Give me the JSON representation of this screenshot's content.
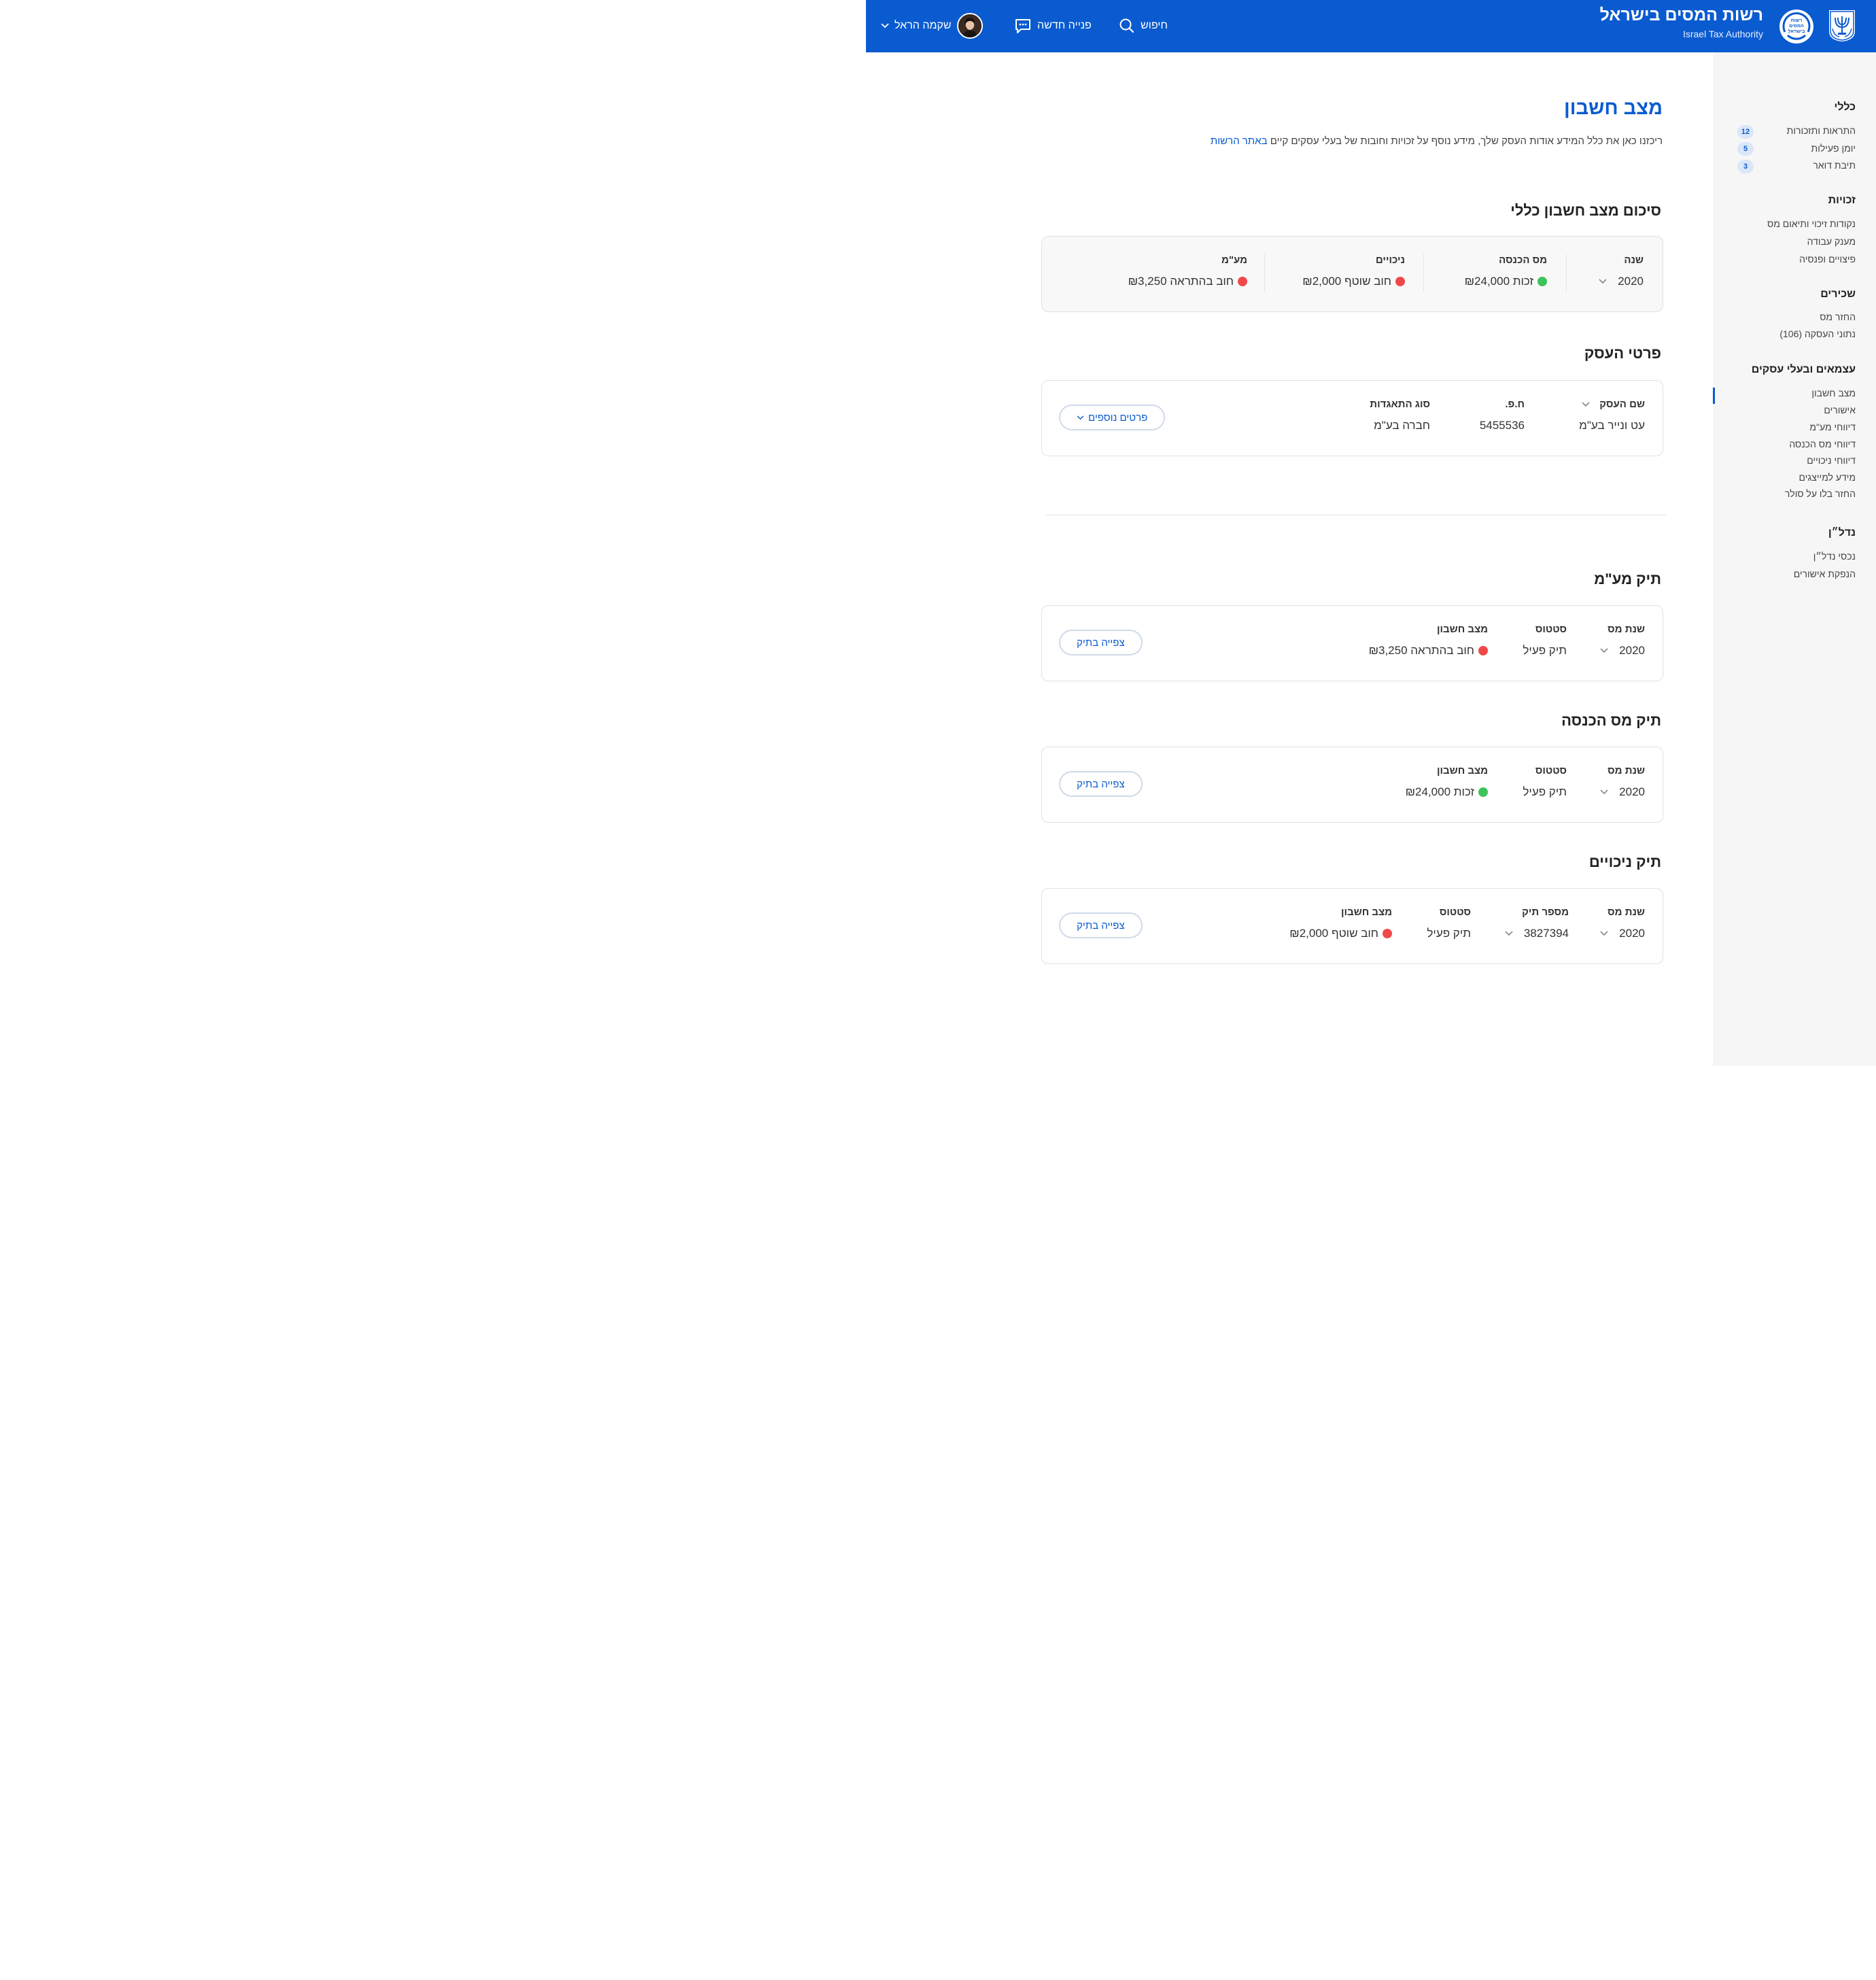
{
  "header": {
    "brand_he": "רשות המסים בישראל",
    "brand_en": "Israel Tax Authority",
    "logo_text_1": "רשות",
    "logo_text_2": "המסים",
    "logo_text_3": "בישראל",
    "emblem_text": "ישראל",
    "search_label": "חיפוש",
    "new_request_label": "פנייה חדשה",
    "user_name": "שקמה הראל",
    "primary_color": "#0a5bd0"
  },
  "sidebar": {
    "sections": [
      {
        "title": "כללי",
        "items": [
          {
            "label": "התראות ותזכורות",
            "badge": "12"
          },
          {
            "label": "יומן פעילות",
            "badge": "5"
          },
          {
            "label": "תיבת דואר",
            "badge": "3"
          }
        ]
      },
      {
        "title": "זכויות",
        "items": [
          {
            "label": "נקודות זיכוי ותיאום מס"
          },
          {
            "label": "מענק עבודה"
          },
          {
            "label": "פיצויים ופנסיה"
          }
        ]
      },
      {
        "title": "שכירים",
        "items": [
          {
            "label": "החזר מס"
          },
          {
            "label": "(106) נתוני העסקה"
          }
        ]
      },
      {
        "title": "עצמאים ובעלי עסקים",
        "items": [
          {
            "label": "מצב חשבון"
          },
          {
            "label": "אישורים"
          },
          {
            "label": "דיווחי מע\"מ"
          },
          {
            "label": "דיווחי מס הכנסה"
          },
          {
            "label": "דיווחי ניכויים"
          },
          {
            "label": "מידע למייצגים"
          },
          {
            "label": "החזר בלו על סולר"
          }
        ]
      },
      {
        "title": "נדל״ן",
        "items": [
          {
            "label": "נכסי נדל״ן"
          },
          {
            "label": "הנפקת אישורים"
          }
        ]
      }
    ]
  },
  "main": {
    "title": "מצב חשבון",
    "intro": "ריכזנו כאן את כלל המידע אודות העסק שלך, מידע נוסף על זכויות וחובות של בעלי עסקים קיים",
    "intro_link": "באתר הרשות",
    "summary": {
      "title": "סיכום מצב חשבון כללי",
      "year_label": "שנה",
      "year_value": "2020",
      "income_label": "מס הכנסה",
      "income_value": "זכות ₪24,000",
      "deductions_label": "ניכויים",
      "deductions_value": "חוב שוטף ₪2,000",
      "vat_label": "מע\"מ",
      "vat_value": "חוב בהתראה ₪3,250"
    },
    "business": {
      "title": "פרטי העסק",
      "name_label": "שם העסק",
      "name_value": "עט ונייר בע\"מ",
      "id_label": "ח.פ.",
      "id_value": "5455536",
      "type_label": "סוג התאגדות",
      "type_value": "חברה בע\"מ",
      "more_button": "פרטים נוספים"
    },
    "vat_file": {
      "title": "תיק מע\"מ",
      "year_label": "שנת מס",
      "year_value": "2020",
      "status_label": "סטטוס",
      "status_value": "תיק פעיל",
      "balance_label": "מצב חשבון",
      "balance_value": "חוב בהתראה ₪3,250",
      "view_button": "צפייה בתיק"
    },
    "income_file": {
      "title": "תיק מס הכנסה",
      "year_label": "שנת מס",
      "year_value": "2020",
      "status_label": "סטטוס",
      "status_value": "תיק פעיל",
      "balance_label": "מצב חשבון",
      "balance_value": "זכות ₪24,000",
      "view_button": "צפייה בתיק"
    },
    "deductions_file": {
      "title": "תיק ניכויים",
      "year_label": "שנת מס",
      "year_value": "2020",
      "file_label": "מספר תיק",
      "file_value": "3827394",
      "status_label": "סטטוס",
      "status_value": "תיק פעיל",
      "balance_label": "מצב חשבון",
      "balance_value": "חוב שוטף ₪2,000",
      "view_button": "צפייה בתיק"
    }
  }
}
